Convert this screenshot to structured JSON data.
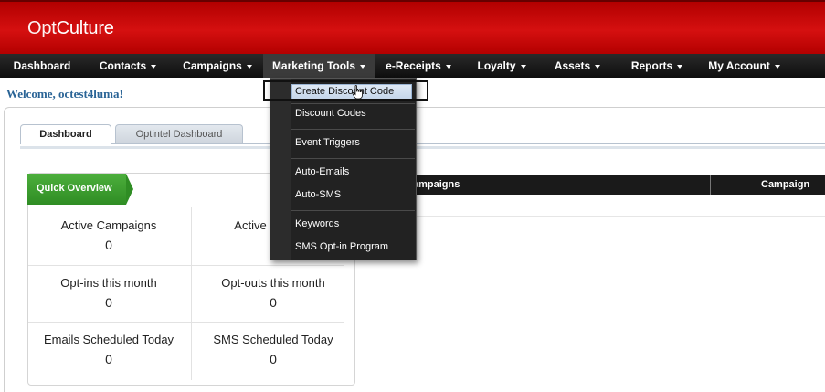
{
  "header": {
    "logo_light": "Opt",
    "logo_bold": "Culture"
  },
  "nav": {
    "items": [
      {
        "label": "Dashboard",
        "caret": false
      },
      {
        "label": "Contacts",
        "caret": true
      },
      {
        "label": "Campaigns",
        "caret": true
      },
      {
        "label": "Marketing Tools",
        "caret": true,
        "active": true
      },
      {
        "label": "e-Receipts",
        "caret": true
      },
      {
        "label": "Loyalty",
        "caret": true
      },
      {
        "label": "Assets",
        "caret": true
      },
      {
        "label": "Reports",
        "caret": true
      },
      {
        "label": "My Account",
        "caret": true
      }
    ]
  },
  "welcome": "Welcome, octest4luma!",
  "tabs": {
    "dashboard": "Dashboard",
    "optintel": "Optintel Dashboard"
  },
  "quick_overview": {
    "title": "Quick Overview",
    "stats": [
      {
        "label": "Active Campaigns",
        "value": "0"
      },
      {
        "label": "Active",
        "value": ""
      },
      {
        "label": "Opt-ins this month",
        "value": "0"
      },
      {
        "label": "Opt-outs this month",
        "value": "0"
      },
      {
        "label": "Emails Scheduled Today",
        "value": "0"
      },
      {
        "label": "SMS Scheduled Today",
        "value": "0"
      }
    ]
  },
  "table": {
    "col1": "ampaigns",
    "col2": "Campaign Typ"
  },
  "dropdown": {
    "items": [
      "Create Discount Code",
      "Discount Codes",
      "Event Triggers",
      "Auto-Emails",
      "Auto-SMS",
      "Keywords",
      "SMS Opt-in Program"
    ]
  },
  "colors": {
    "header_red": "#c80808",
    "nav_black": "#111111",
    "quick_overview_green": "#3a9a2e",
    "welcome_blue": "#2a6496"
  }
}
